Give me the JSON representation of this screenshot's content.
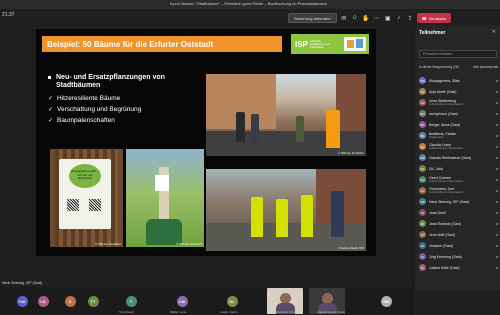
{
  "window": {
    "title": "Input-Session \"Stadtbäume\" – Research goes Public – Baufeschung im Praxisaustausch"
  },
  "meeting": {
    "elapsed": "21:37"
  },
  "controls": {
    "request_label": "Steuerung anfordern",
    "leave_label": "Verlassen",
    "icons": [
      "chat-icon",
      "people-icon",
      "raise-hand-icon",
      "more-icon",
      "camera-icon",
      "mic-icon",
      "share-icon"
    ]
  },
  "slide": {
    "title": "Beispiel: 50 Bäume für die Erfurter Oststadt",
    "logo_text": "ISP",
    "logo_sub": "Institut für Stadtplanung und Partizipation",
    "main_bullet": "Neu- und Ersatzpflanzungen von Stadtbäumen",
    "checks": [
      "Hitzeresiliente Bäume",
      "Verschattung und Begrünung",
      "Baumpatenschaften"
    ],
    "sign_text": "Baumpatenschaft – Ich bin ein Baumpate",
    "captions": [
      "© ISP der FH Erfurt",
      "© ISP der FH Erfurt",
      "© ISP der FH Erfurt",
      "© Grüne Stadt, ISP"
    ]
  },
  "panel": {
    "title": "Teilnehmer",
    "search_placeholder": "Personen einladen",
    "section_label": "In dieser Besprechung (26)",
    "mute_all": "Alle stummschalt.",
    "participants": [
      {
        "initials": "MS",
        "name": "Muckagemba, Silke",
        "role": "",
        "color": "#6b6bd4"
      },
      {
        "initials": "AA",
        "name": "Anja Abele (Gast)",
        "role": "",
        "color": "#9a7d5a"
      },
      {
        "initials": "AS",
        "name": "Anna Stiefenberg",
        "role": "Außerhalb der Organisation",
        "color": "#a05a5a"
      },
      {
        "initials": "AN",
        "name": "anonymous (Gast)",
        "role": "",
        "color": "#777777"
      },
      {
        "initials": "BA",
        "name": "Berger, Anna (Gast)",
        "role": "",
        "color": "#8d5aa0"
      },
      {
        "initials": "BF",
        "name": "Breitbeck, Fabian",
        "role": "Organisator",
        "color": "#5a8da0"
      },
      {
        "initials": "CL",
        "name": "Claudia Loeck",
        "role": "Außerhalb der Organisation",
        "color": "#c77d3a"
      },
      {
        "initials": "CW",
        "name": "Claudia Weißsteiner (Gast)",
        "role": "",
        "color": "#5a7da0"
      },
      {
        "initials": "DK",
        "name": "DK, Julia",
        "role": "",
        "color": "#7d7d4a"
      },
      {
        "initials": "GC",
        "name": "Geert Coenen",
        "role": "Außerhalb der Organisation",
        "color": "#4a8d6a"
      },
      {
        "initials": "GJ",
        "name": "Grohmann, Jörn",
        "role": "Außerhalb der Organisation",
        "color": "#a06a4a"
      },
      {
        "initials": "HS",
        "name": "Henk Strenzig, ISP (Gast)",
        "role": "",
        "color": "#4a7d8d"
      },
      {
        "initials": "JS",
        "name": "Jana Stuhl",
        "role": "",
        "color": "#8d4a6a"
      },
      {
        "initials": "JR",
        "name": "Jana Rodnick (Gast)",
        "role": "",
        "color": "#6a8d4a"
      },
      {
        "initials": "JW",
        "name": "Jens Wolf (Gast)",
        "role": "",
        "color": "#8d6a4a"
      },
      {
        "initials": "JA",
        "name": "Janssen (Gast)",
        "role": "",
        "color": "#4a6a8d"
      },
      {
        "initials": "JK",
        "name": "Jörg Kronberg (Gast)",
        "role": "",
        "color": "#7a5a9a"
      },
      {
        "initials": "JK",
        "name": "Juliane Kölle (Gast)",
        "role": "",
        "color": "#9a5a7a"
      }
    ]
  },
  "stage": {
    "speaker_name": "Henk Strenzig, ISP (Gast)"
  },
  "strip": {
    "tiles": [
      {
        "type": "avatar",
        "initials": "+16",
        "name": "",
        "color": "#5b5fc7"
      },
      {
        "type": "avatar",
        "initials": "LD",
        "name": "",
        "color": "#b05a8a"
      },
      {
        "type": "avatar",
        "initials": "S",
        "name": "",
        "color": "#c0704a"
      },
      {
        "type": "avatar",
        "initials": "TT",
        "name": "",
        "color": "#6a8d4a"
      },
      {
        "type": "avatar",
        "initials": "T",
        "name": "Toni (Gast)",
        "color": "#4a8d7a"
      },
      {
        "type": "avatar",
        "initials": "LM",
        "name": "Möller, Lena",
        "color": "#8d6ab0"
      },
      {
        "type": "avatar",
        "initials": "KL",
        "name": "Loeck, Katrin",
        "color": "#7a8d4a"
      },
      {
        "type": "video",
        "initials": "",
        "name": "Breitbeck, Fabian",
        "color": "#d9cfc2"
      },
      {
        "type": "video",
        "initials": "",
        "name": "Claudia Loeck (Gast)",
        "color": "#3a3a3a"
      },
      {
        "type": "avatar",
        "initials": "SM",
        "name": "",
        "color": "#b0b0b0"
      }
    ]
  }
}
